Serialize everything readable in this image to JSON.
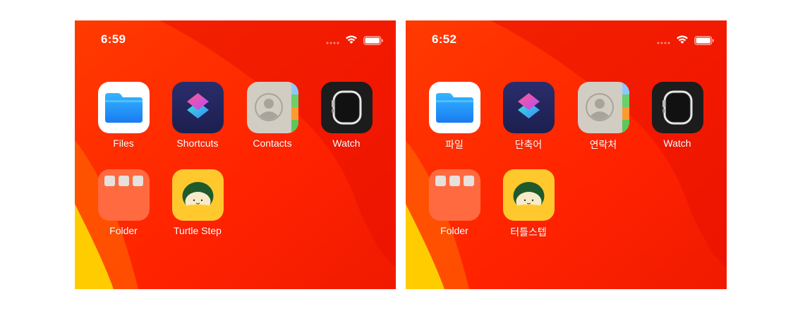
{
  "screens": [
    {
      "status_time": "6:59",
      "apps": [
        {
          "label": "Files",
          "icon": "files-icon"
        },
        {
          "label": "Shortcuts",
          "icon": "shortcuts-icon"
        },
        {
          "label": "Contacts",
          "icon": "contacts-icon"
        },
        {
          "label": "Watch",
          "icon": "watch-icon"
        },
        {
          "label": "Folder",
          "icon": "folder-icon"
        },
        {
          "label": "Turtle Step",
          "icon": "turtle-step-icon"
        }
      ]
    },
    {
      "status_time": "6:52",
      "apps": [
        {
          "label": "파일",
          "icon": "files-icon"
        },
        {
          "label": "단축어",
          "icon": "shortcuts-icon"
        },
        {
          "label": "연락처",
          "icon": "contacts-icon"
        },
        {
          "label": "Watch",
          "icon": "watch-icon"
        },
        {
          "label": "Folder",
          "icon": "folder-icon"
        },
        {
          "label": "터틀스텝",
          "icon": "turtle-step-icon"
        }
      ]
    }
  ],
  "colors": {
    "wallpaper_base": "#ff2a00",
    "wallpaper_dark": "#e81100",
    "wallpaper_yellow": "#ffd000",
    "text": "#ffffff"
  }
}
